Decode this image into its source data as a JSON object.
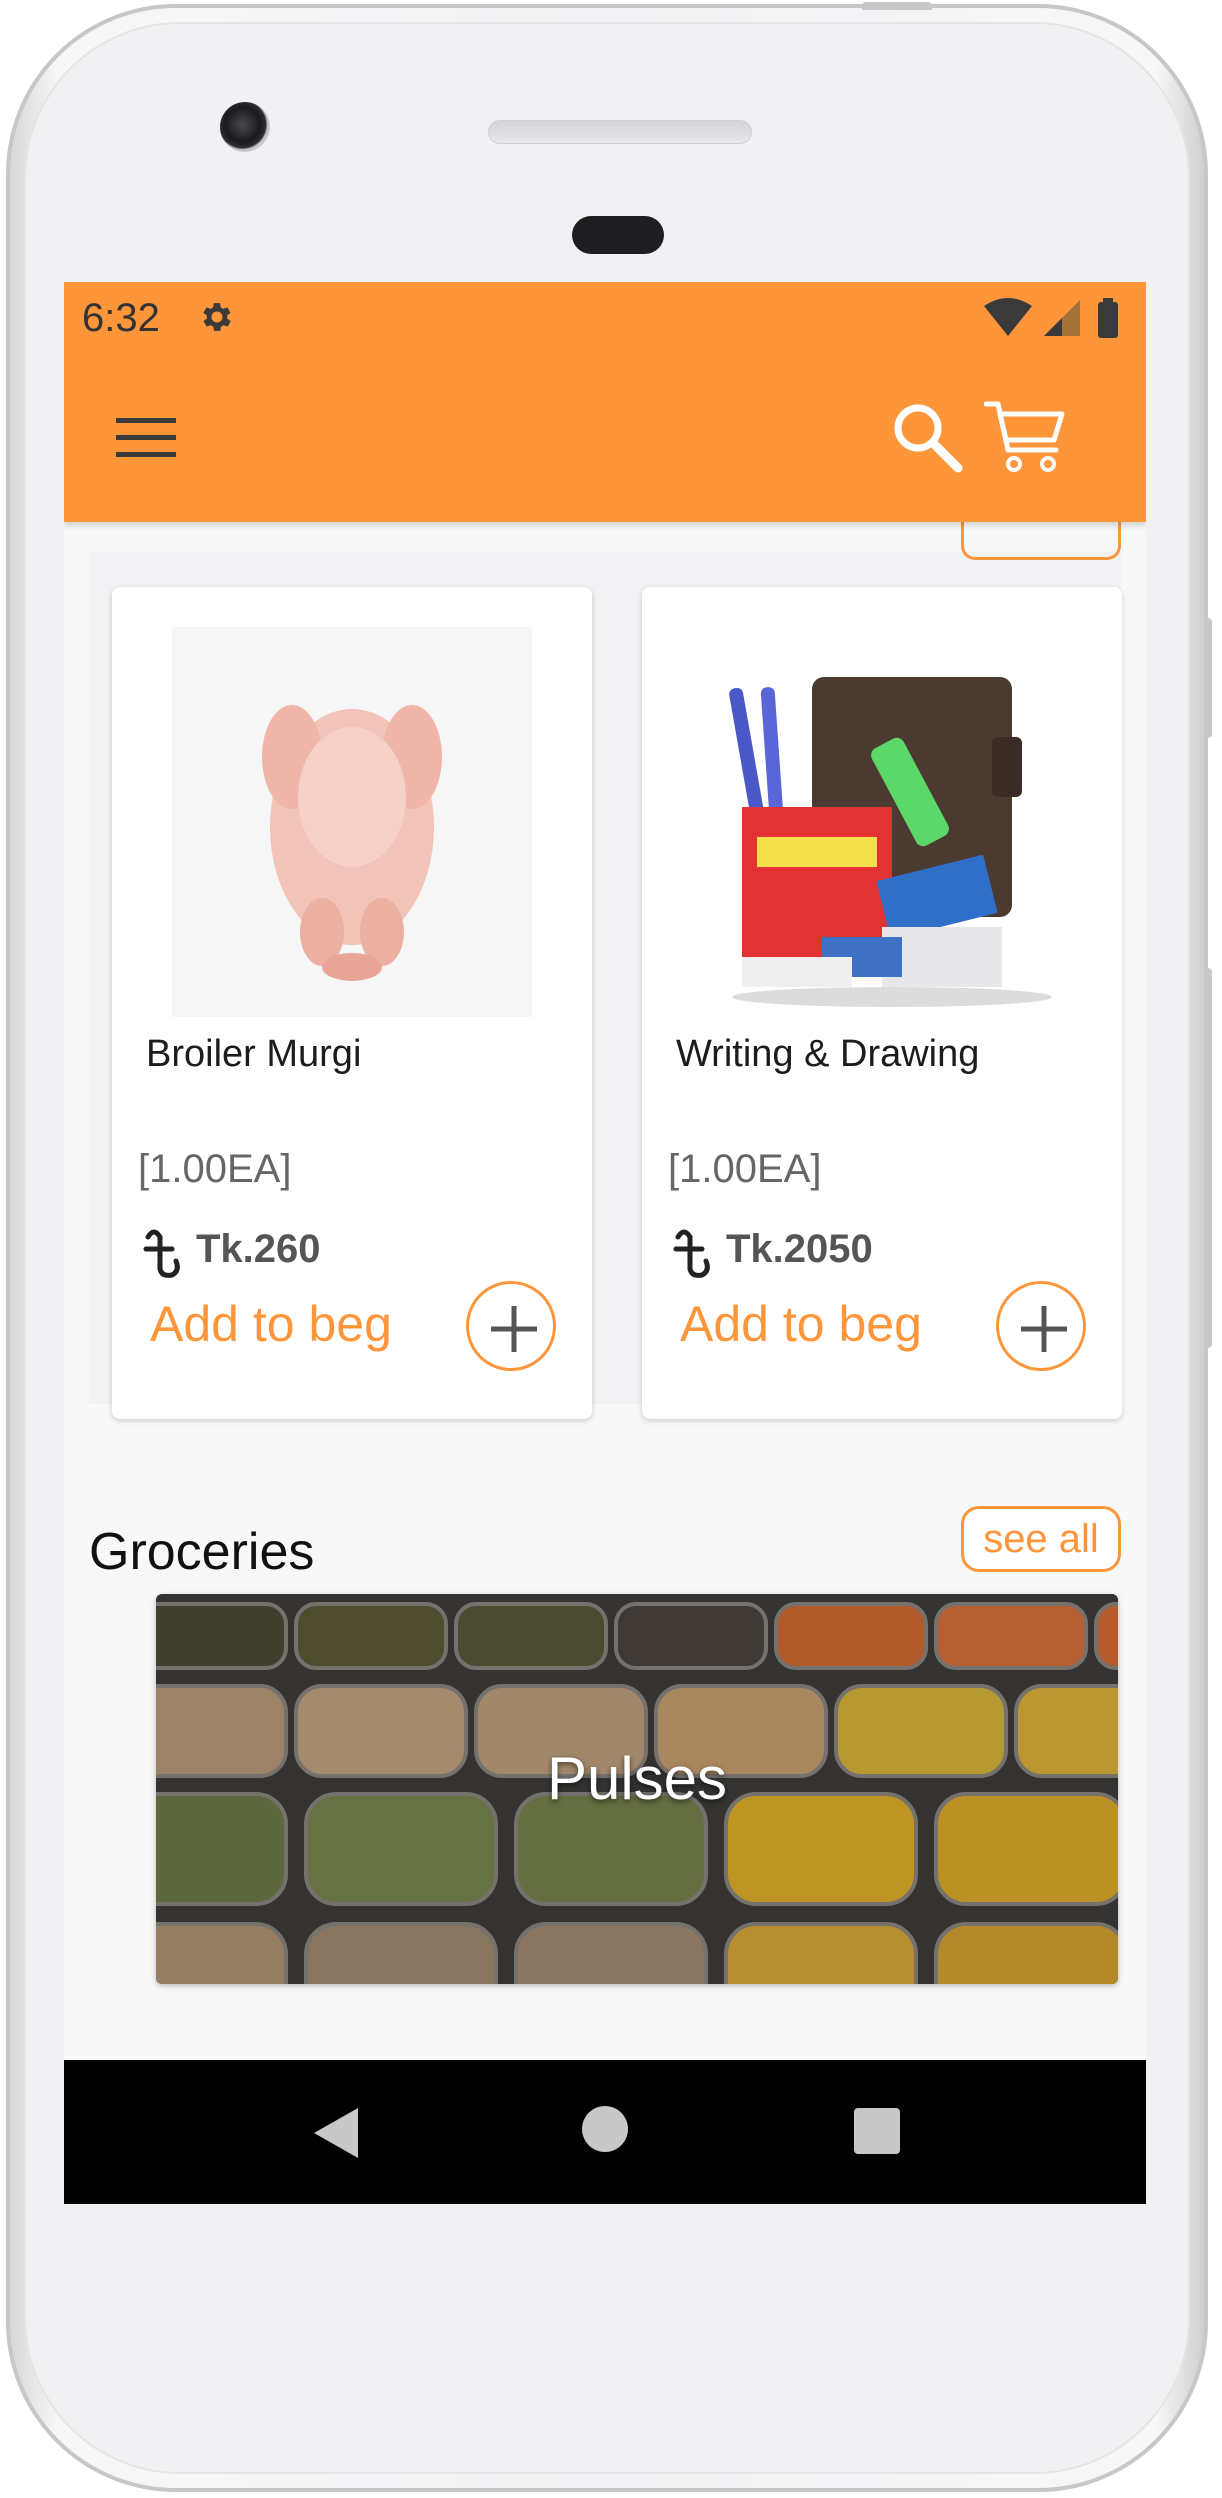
{
  "status_bar": {
    "time": "6:32"
  },
  "colors": {
    "accent": "#fd963a",
    "nav_bar": "#000000",
    "screen_bg": "#f8f8f9"
  },
  "icons": {
    "menu": "hamburger-icon",
    "search": "search-icon",
    "cart": "cart-icon",
    "add": "plus-icon",
    "currency": "taka-icon"
  },
  "offers": [
    {
      "name": "Broiler Murgi",
      "qty": "[1.00EA]",
      "price": "Tk.260",
      "add_label": "Add to beg"
    },
    {
      "name": "Writing & Drawing",
      "qty": "[1.00EA]",
      "price": "Tk.2050",
      "add_label": "Add to beg"
    }
  ],
  "groceries": {
    "title": "Groceries",
    "see_all": "see all",
    "banner_label": "Pulses"
  }
}
